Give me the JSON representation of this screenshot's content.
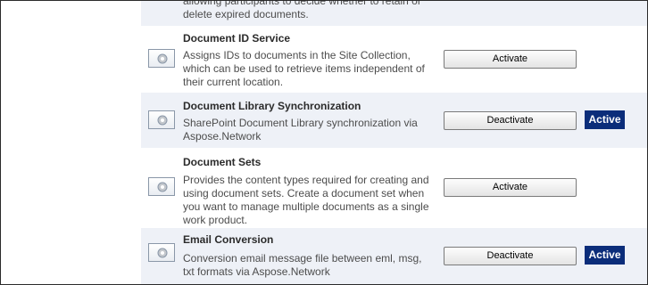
{
  "features": [
    {
      "title": "",
      "description_lines": [
        "allowing participants to decide whether to retain or",
        "delete expired documents."
      ],
      "action_label": "",
      "status_badge": ""
    },
    {
      "title": "Document ID Service",
      "description_lines": [
        "Assigns IDs to documents in the Site Collection,",
        "which can be used to retrieve items independent of",
        "their current location."
      ],
      "action_label": "Activate",
      "status_badge": ""
    },
    {
      "title": "Document Library Synchronization",
      "description_lines": [
        "SharePoint Document Library synchronization via",
        "Aspose.Network"
      ],
      "action_label": "Deactivate",
      "status_badge": "Active"
    },
    {
      "title": "Document Sets",
      "description_lines": [
        "Provides the content types required for creating and",
        "using document sets. Create a document set when",
        "you want to manage multiple documents as a single",
        "work product."
      ],
      "action_label": "Activate",
      "status_badge": ""
    },
    {
      "title": "Email Conversion",
      "description_lines": [
        "Conversion email message file between eml, msg,",
        "txt formats via Aspose.Network"
      ],
      "action_label": "Deactivate",
      "status_badge": "Active"
    }
  ],
  "icons": {
    "feature": "feature-gear-icon"
  },
  "colors": {
    "active_badge": "#0b2d7a",
    "alt_row": "#eef1f7"
  }
}
